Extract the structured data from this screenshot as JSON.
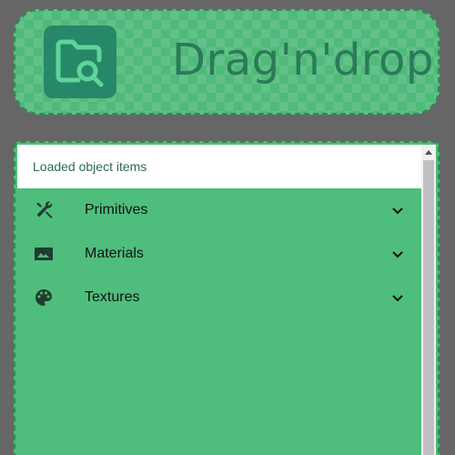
{
  "dropzone": {
    "title": "Drag'n'drop",
    "icon": "folder-search-icon"
  },
  "panel": {
    "header": "Loaded object items",
    "items": [
      {
        "label": "Primitives",
        "icon": "tools-icon"
      },
      {
        "label": "Materials",
        "icon": "image-icon"
      },
      {
        "label": "Textures",
        "icon": "palette-icon"
      }
    ]
  },
  "colors": {
    "background": "#666666",
    "accent_green": "#4fbd7c",
    "dark_green": "#268868",
    "border_green": "#2e8b57"
  }
}
